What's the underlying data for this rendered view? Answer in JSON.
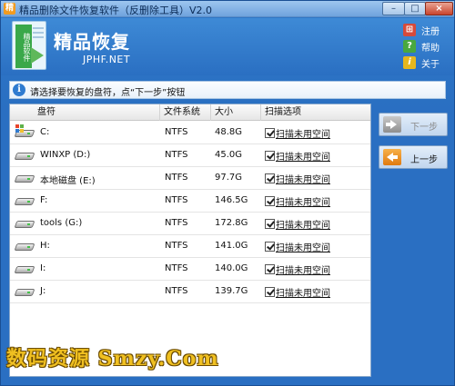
{
  "window": {
    "title": "精品删除文件恢复软件（反删除工具）V2.0",
    "minimize": "–",
    "maximize": "□",
    "close": "×"
  },
  "header": {
    "logo_text": "精品软件",
    "brand": "精品恢复",
    "url": "JPHF.NET",
    "links": [
      {
        "label": "注册",
        "icon": "register-icon"
      },
      {
        "label": "帮助",
        "icon": "help-icon"
      },
      {
        "label": "关于",
        "icon": "about-icon"
      }
    ]
  },
  "info": {
    "icon_glyph": "i",
    "text": "请选择要恢复的盘符，点“下一步”按钮"
  },
  "table": {
    "columns": [
      "盘符",
      "文件系统",
      "大小",
      "扫描选项"
    ],
    "rows": [
      {
        "name": "C:",
        "fs": "NTFS",
        "size": "48.8G",
        "scan": "扫描未用空间",
        "checked": true,
        "icon": "system-drive-icon"
      },
      {
        "name": "WINXP (D:)",
        "fs": "NTFS",
        "size": "45.0G",
        "scan": "扫描未用空间",
        "checked": true,
        "icon": "drive-icon"
      },
      {
        "name": "本地磁盘 (E:)",
        "fs": "NTFS",
        "size": "97.7G",
        "scan": "扫描未用空间",
        "checked": true,
        "icon": "drive-icon"
      },
      {
        "name": "F:",
        "fs": "NTFS",
        "size": "146.5G",
        "scan": "扫描未用空间",
        "checked": true,
        "icon": "drive-icon"
      },
      {
        "name": "tools (G:)",
        "fs": "NTFS",
        "size": "172.8G",
        "scan": "扫描未用空间",
        "checked": true,
        "icon": "drive-icon"
      },
      {
        "name": "H:",
        "fs": "NTFS",
        "size": "141.0G",
        "scan": "扫描未用空间",
        "checked": true,
        "icon": "drive-icon"
      },
      {
        "name": "I:",
        "fs": "NTFS",
        "size": "140.0G",
        "scan": "扫描未用空间",
        "checked": true,
        "icon": "drive-icon"
      },
      {
        "name": "J:",
        "fs": "NTFS",
        "size": "139.7G",
        "scan": "扫描未用空间",
        "checked": true,
        "icon": "drive-icon"
      }
    ]
  },
  "nav": {
    "next_label": "下一步",
    "prev_label": "上一步"
  },
  "watermark": "数码资源 Smzy.Com",
  "colors": {
    "window_blue": "#2a6fc2",
    "watermark": "#f0c021",
    "prev_arrow": "#e07a10"
  }
}
